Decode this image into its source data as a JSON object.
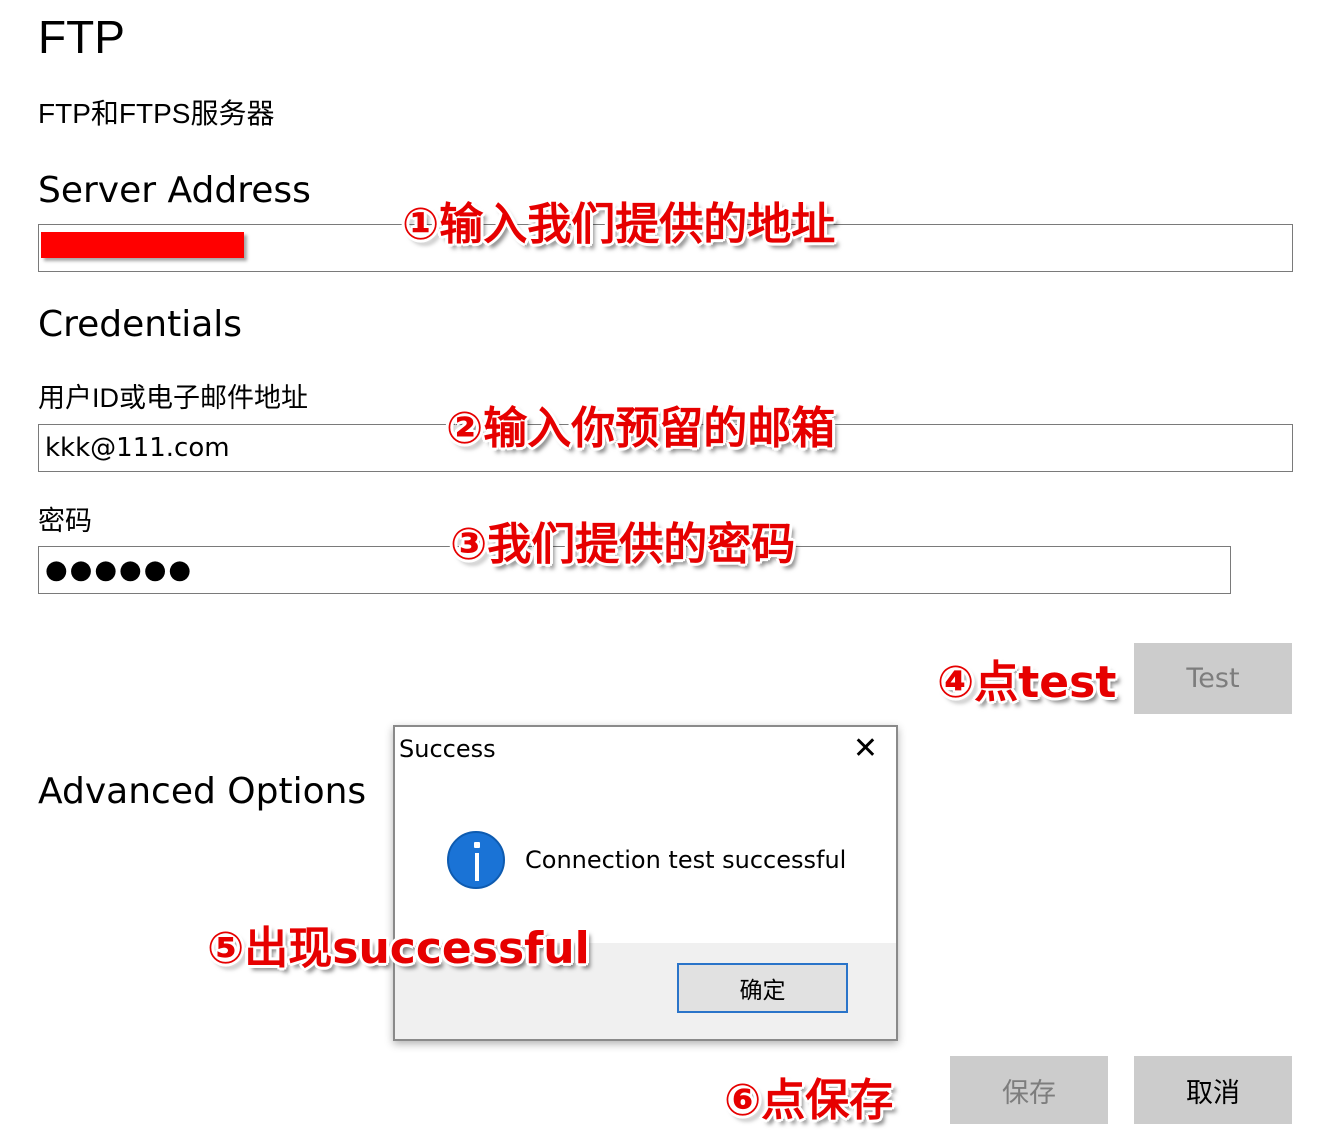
{
  "header": {
    "title": "FTP",
    "subtitle": "FTP和FTPS服务器"
  },
  "server": {
    "heading": "Server Address",
    "value_redacted": true
  },
  "credentials": {
    "heading": "Credentials",
    "user_label": "用户ID或电子邮件地址",
    "user_value": "kkk@111.com",
    "password_label": "密码",
    "password_masked": "●●●●●●"
  },
  "buttons": {
    "test": "Test",
    "save": "保存",
    "cancel": "取消"
  },
  "advanced": {
    "heading": "Advanced Options"
  },
  "dialog": {
    "title": "Success",
    "close_glyph": "✕",
    "message": "Connection test successful",
    "ok": "确定"
  },
  "annotations": {
    "step1": "①输入我们提供的地址",
    "step2": "②输入你预留的邮箱",
    "step3": "③我们提供的密码",
    "step4": "④点test",
    "step5": "⑤出现successful",
    "step6": "⑥点保存"
  },
  "colors": {
    "annotation": "#e60000",
    "redaction": "#ff0000",
    "info_icon": "#1a73d6",
    "button_gray": "#cccccc"
  }
}
